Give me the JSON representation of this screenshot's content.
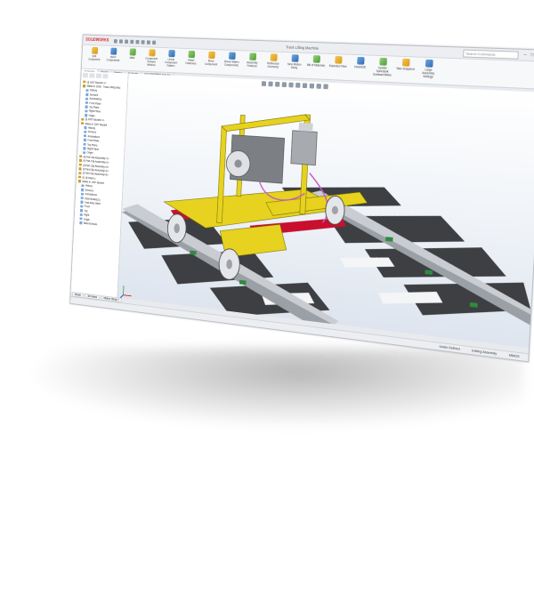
{
  "app": {
    "logo": "SOLIDWORKS",
    "document_title": "Track Lifting Machine",
    "search_placeholder": "Search Commands"
  },
  "window_controls": [
    "–",
    "□",
    "×"
  ],
  "ribbon": {
    "buttons": [
      {
        "label": "Edit Component",
        "icon": "edit-component-icon"
      },
      {
        "label": "Insert Components",
        "icon": "insert-components-icon"
      },
      {
        "label": "Mate",
        "icon": "mate-icon"
      },
      {
        "label": "Component Preview Window",
        "icon": "preview-window-icon"
      },
      {
        "label": "Linear Component Pattern",
        "icon": "linear-pattern-icon"
      },
      {
        "label": "Smart Fasteners",
        "icon": "smart-fasteners-icon"
      },
      {
        "label": "Move Component",
        "icon": "move-component-icon"
      },
      {
        "label": "Show Hidden Components",
        "icon": "show-hidden-icon"
      },
      {
        "label": "Assembly Features",
        "icon": "assembly-features-icon"
      },
      {
        "label": "Reference Geometry",
        "icon": "reference-geometry-icon"
      },
      {
        "label": "New Motion Study",
        "icon": "motion-study-icon"
      },
      {
        "label": "Bill of Materials",
        "icon": "bom-icon"
      },
      {
        "label": "Exploded View",
        "icon": "exploded-view-icon"
      },
      {
        "label": "Instant3D",
        "icon": "instant3d-icon"
      },
      {
        "label": "Update Speedpak Subassemblies",
        "icon": "speedpak-icon"
      },
      {
        "label": "Take Snapshot",
        "icon": "snapshot-icon"
      },
      {
        "label": "Large Assembly Settings",
        "icon": "large-assembly-icon"
      }
    ]
  },
  "command_tabs": [
    "Assembly",
    "Sketch",
    "Markup",
    "Evaluate",
    "SOLIDWORKS Add-Ins"
  ],
  "feature_tree": {
    "nodes": [
      {
        "label": "(f) 1007 Bauteil<1>",
        "type": "a"
      },
      {
        "label": "Mates in 1008 - Track Lifting Mac",
        "type": "a"
      },
      {
        "label": "History",
        "type": "p"
      },
      {
        "label": "Sensors",
        "type": "p"
      },
      {
        "label": "Annotations",
        "type": "p"
      },
      {
        "label": "Front Plane",
        "type": "p"
      },
      {
        "label": "Top Plane",
        "type": "p"
      },
      {
        "label": "Right Plane",
        "type": "p"
      },
      {
        "label": "Origin",
        "type": "p"
      },
      {
        "label": "(f) 1007 Bauteil<1>",
        "type": "a"
      },
      {
        "label": "Mates in 1007 Bauteil",
        "type": "a"
      },
      {
        "label": "History",
        "type": "p"
      },
      {
        "label": "Sensors",
        "type": "p"
      },
      {
        "label": "Annotations",
        "type": "p"
      },
      {
        "label": "Front Plane",
        "type": "p"
      },
      {
        "label": "Top Plane",
        "type": "p"
      },
      {
        "label": "Right Plane",
        "type": "p"
      },
      {
        "label": "Origin",
        "type": "p"
      },
      {
        "label": "(f) Part Clip Assembly<1>",
        "type": "a"
      },
      {
        "label": "(f) Part Clip Assembly<2>",
        "type": "a"
      },
      {
        "label": "(f) Part Clip Assembly<3>",
        "type": "a"
      },
      {
        "label": "(f) Part Clip Assembly<4>",
        "type": "a"
      },
      {
        "label": "(f) Part Clip Assembly<5>",
        "type": "a"
      },
      {
        "label": "(f) 18 Rail<1>",
        "type": "a"
      },
      {
        "label": "Mates in 1007 Bauteil",
        "type": "a"
      },
      {
        "label": "History",
        "type": "p"
      },
      {
        "label": "Sensors",
        "type": "p"
      },
      {
        "label": "Annotations",
        "type": "p"
      },
      {
        "label": "Solid Bodies(1)",
        "type": "p"
      },
      {
        "label": "Cast Alloy Steel",
        "type": "p"
      },
      {
        "label": "Front",
        "type": "p"
      },
      {
        "label": "Top",
        "type": "p"
      },
      {
        "label": "Right",
        "type": "p"
      },
      {
        "label": "Origin",
        "type": "p"
      },
      {
        "label": "Base-Extrude",
        "type": "p"
      }
    ]
  },
  "bottom_tabs": [
    "Model",
    "3D Views",
    "Motion Study 1"
  ],
  "status": {
    "definition": "Under Defined",
    "mode": "Editing Assembly",
    "units": "MMGS"
  },
  "colors": {
    "machine_yellow": "#e6d21f",
    "frame_red": "#c8102e",
    "rail_steel": "#9aa0a6",
    "sleeper": "#3d3f42",
    "clip_green": "#2e8b3e"
  }
}
